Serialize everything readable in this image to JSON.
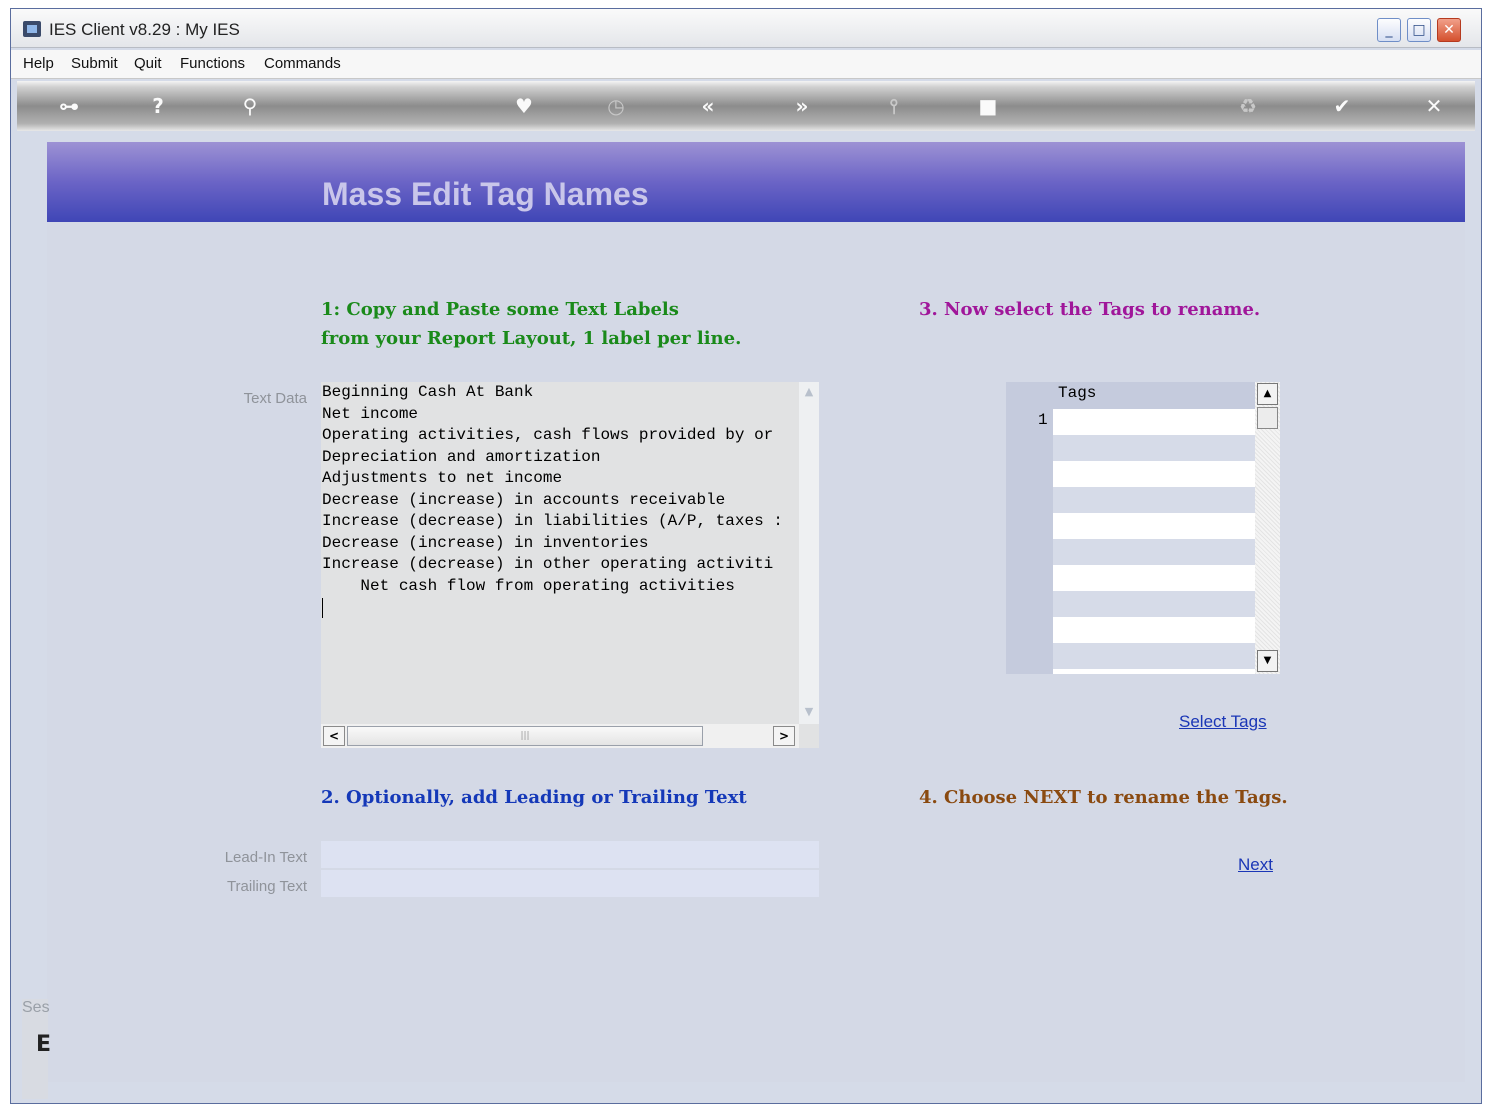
{
  "window": {
    "title": "IES Client v8.29 : My IES"
  },
  "menu": [
    "Help",
    "Submit",
    "Quit",
    "Functions",
    "Commands"
  ],
  "toolbar_icons": [
    "key-icon",
    "help-icon",
    "search-icon",
    "heart-icon",
    "clock-icon",
    "back-icon",
    "forward-icon",
    "tools-icon",
    "chip-icon",
    "recycle-icon",
    "check-icon",
    "cancel-icon"
  ],
  "page": {
    "title": "Mass Edit Tag Names",
    "step1_line1": "1: Copy and Paste some Text Labels",
    "step1_line2": "from your Report Layout, 1 label per line.",
    "step2": "2. Optionally, add Leading or Trailing Text",
    "step3": "3. Now select the Tags to rename.",
    "step4": "4. Choose NEXT to rename the Tags.",
    "text_data_label": "Text Data",
    "text_data_value": "Beginning Cash At Bank\nNet income\nOperating activities, cash flows provided by or\nDepreciation and amortization\nAdjustments to net income\nDecrease (increase) in accounts receivable\nIncrease (decrease) in liabilities (A/P, taxes :\nDecrease (increase) in inventories\nIncrease (decrease) in other operating activiti\n    Net cash flow from operating activities",
    "lead_in_label": "Lead-In Text",
    "trailing_label": "Trailing Text",
    "lead_in_value": "",
    "trailing_value": "",
    "tags_header": "Tags",
    "tags_row_number": "1",
    "select_tags": "Select Tags",
    "next": "Next"
  },
  "status": {
    "session_text": "Ses",
    "icon_glyph": "E"
  },
  "colors": {
    "header_top": "#9d92d4",
    "header_bottom": "#3f46b6",
    "step1": "#1a8a1a",
    "step2": "#1438b8",
    "step3": "#a0169a",
    "step4": "#8a4a10"
  }
}
